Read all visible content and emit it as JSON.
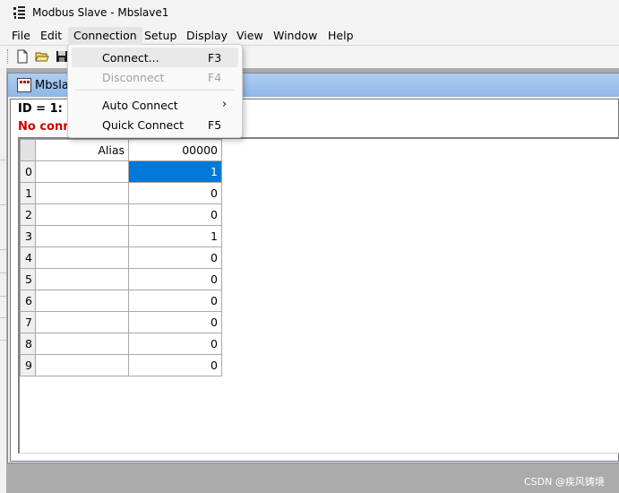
{
  "window": {
    "title": "Modbus Slave - Mbslave1"
  },
  "menubar": {
    "items": [
      {
        "label": "File"
      },
      {
        "label": "Edit"
      },
      {
        "label": "Connection"
      },
      {
        "label": "Setup"
      },
      {
        "label": "Display"
      },
      {
        "label": "View"
      },
      {
        "label": "Window"
      },
      {
        "label": "Help"
      }
    ]
  },
  "toolbar": {
    "icons": [
      "new-file-icon",
      "open-folder-icon",
      "save-icon"
    ]
  },
  "connection_menu": {
    "items": [
      {
        "label": "Connect...",
        "shortcut": "F3",
        "enabled": true
      },
      {
        "label": "Disconnect",
        "shortcut": "F4",
        "enabled": false
      },
      {
        "label": "Auto Connect",
        "shortcut": "",
        "submenu": true,
        "arrow": "›"
      },
      {
        "label": "Quick Connect",
        "shortcut": "F5",
        "enabled": true
      }
    ]
  },
  "child_window": {
    "title": "Mbslav",
    "id_line": "ID = 1: F",
    "status_line": "No conne"
  },
  "grid": {
    "columns": [
      "Alias",
      "00000"
    ],
    "rows": [
      {
        "index": "0",
        "alias": "",
        "value": "1"
      },
      {
        "index": "1",
        "alias": "",
        "value": "0"
      },
      {
        "index": "2",
        "alias": "",
        "value": "0"
      },
      {
        "index": "3",
        "alias": "",
        "value": "1"
      },
      {
        "index": "4",
        "alias": "",
        "value": "0"
      },
      {
        "index": "5",
        "alias": "",
        "value": "0"
      },
      {
        "index": "6",
        "alias": "",
        "value": "0"
      },
      {
        "index": "7",
        "alias": "",
        "value": "0"
      },
      {
        "index": "8",
        "alias": "",
        "value": "0"
      },
      {
        "index": "9",
        "alias": "",
        "value": "0"
      }
    ],
    "selected_row": 0
  },
  "watermark": "CSDN @疾风铸境",
  "colors": {
    "selection": "#0078d7",
    "error_text": "#d00000",
    "title_gradient": "#aecdf0"
  }
}
